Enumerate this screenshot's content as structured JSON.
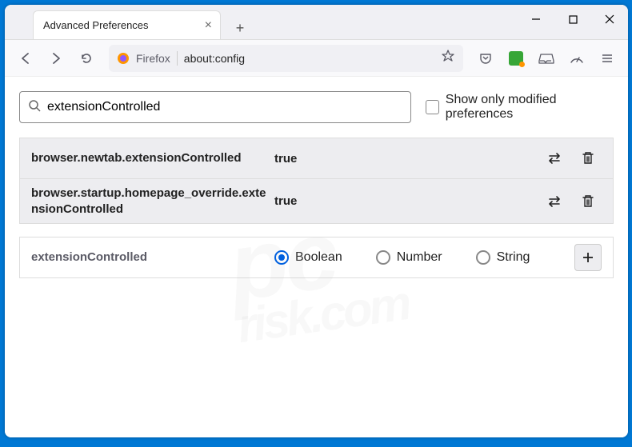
{
  "titlebar": {
    "tab_title": "Advanced Preferences"
  },
  "toolbar": {
    "identity_label": "Firefox",
    "url": "about:config"
  },
  "search": {
    "value": "extensionControlled",
    "checkbox_label": "Show only modified preferences"
  },
  "prefs": [
    {
      "name": "browser.newtab.extensionControlled",
      "value": "true"
    },
    {
      "name": "browser.startup.homepage_override.extensionControlled",
      "value": "true"
    }
  ],
  "newpref": {
    "name": "extensionControlled",
    "types": {
      "boolean": "Boolean",
      "number": "Number",
      "string": "String"
    }
  },
  "watermark": {
    "line1": "pc",
    "line2": "risk.com"
  }
}
